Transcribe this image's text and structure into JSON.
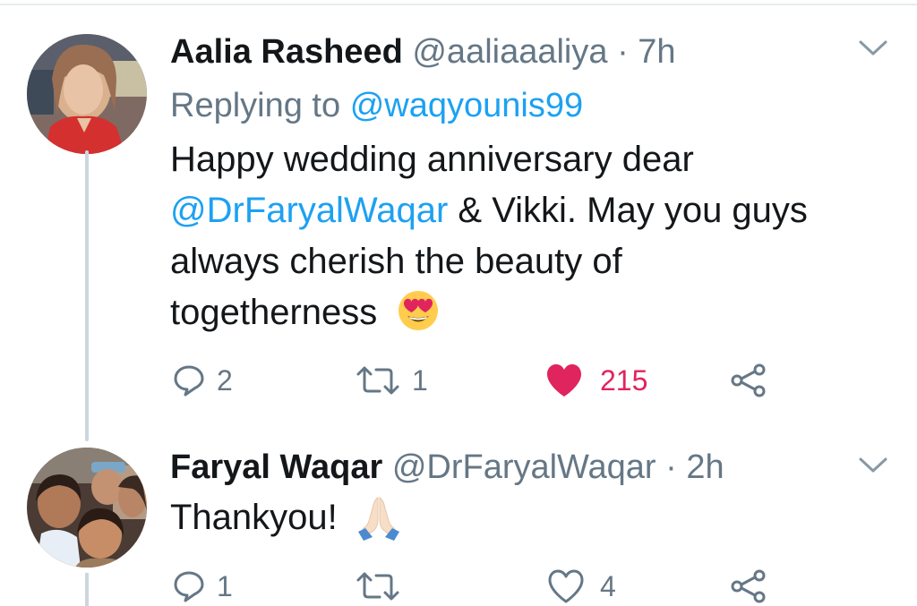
{
  "tweets": [
    {
      "name": "Aalia Rasheed",
      "handle": "@aaliaaaliya",
      "separator": "·",
      "time": "7h",
      "replying_prefix": "Replying to",
      "replying_handle": "@waqyounis99",
      "body": {
        "line1": "Happy wedding anniversary dear",
        "line2_mention": "@DrFaryalWaqar",
        "line2_rest": " & Vikki. May you guys",
        "line3": "always cherish the beauty of",
        "line4": "togetherness",
        "emoji": "heart-eyes-emoji"
      },
      "actions": {
        "replies": "2",
        "retweets": "1",
        "likes": "215",
        "liked": true
      }
    },
    {
      "name": "Faryal Waqar",
      "handle": "@DrFaryalWaqar",
      "separator": "·",
      "time": "2h",
      "body": {
        "line1": "Thankyou!",
        "emoji": "folded-hands-emoji"
      },
      "actions": {
        "replies": "1",
        "retweets": "",
        "likes": "4",
        "liked": false
      }
    }
  ],
  "colors": {
    "link": "#1da1f2",
    "secondary": "#657786",
    "like": "#e0245e",
    "thread_line": "#ccd6dd"
  }
}
